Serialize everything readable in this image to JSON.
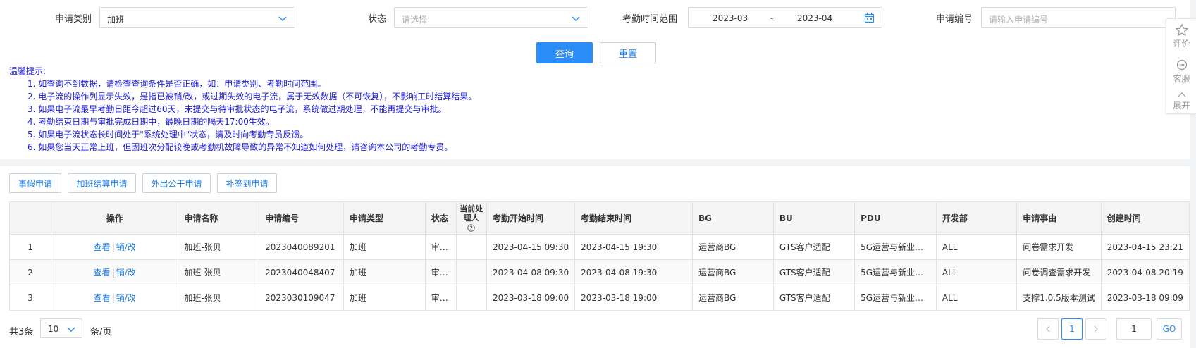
{
  "search": {
    "category_label": "申请类别",
    "category_value": "加班",
    "status_label": "状态",
    "status_placeholder": "请选择",
    "range_label": "考勤时间范围",
    "range_start": "2023-03",
    "range_sep": "-",
    "range_end": "2023-04",
    "number_label": "申请编号",
    "number_placeholder": "请输入申请编号",
    "query_button": "查询",
    "reset_button": "重置"
  },
  "tips": {
    "title": "温馨提示:",
    "items": [
      "1. 如查询不到数据，请检查查询条件是否正确，如：申请类别、考勤时间范围。",
      "2. 电子流的操作列显示失效，是指已被销/改，或过期失效的电子流，属于无效数据（不可恢复），不影响工时结算结果。",
      "3. 如果电子流最早考勤日距今超过60天，未提交与待审批状态的电子流，系统做过期处理，不能再提交与审批。",
      "4. 考勤结束日期与审批完成日期中，最晚日期的隔天17:00生效。",
      "5. 如果电子流状态长时间处于\"系统处理中\"状态，请及时向考勤专员反馈。",
      "6. 如果您当天正常上班，但因班次分配较晚或考勤机故障导致的异常不知道如何处理，请咨询本公司的考勤专员。"
    ]
  },
  "float_panel": {
    "rate_label": "评价",
    "service_label": "客服",
    "expand_label": "展开"
  },
  "tabs": [
    "事假申请",
    "加班结算申请",
    "外出公干申请",
    "补签到申请"
  ],
  "table": {
    "headers": {
      "index": "",
      "op": "操作",
      "name": "申请名称",
      "number": "申请编号",
      "type": "申请类型",
      "status": "状态",
      "handler": "当前处理人",
      "start": "考勤开始时间",
      "end": "考勤结束时间",
      "bg": "BG",
      "bu": "BU",
      "pdu": "PDU",
      "dept": "开发部",
      "reason": "申请事由",
      "created": "创建时间"
    },
    "view_label": "查看",
    "op_sep": "|",
    "edit_label": "销/改",
    "rows": [
      {
        "index": "1",
        "name": "加班-张贝",
        "number": "2023040089201",
        "type": "加班",
        "status": "审…",
        "handler": "",
        "start": "2023-04-15 09:30",
        "end": "2023-04-15 19:30",
        "bg": "运营商BG",
        "bu": "GTS客户适配",
        "pdu": "5G运营与新业…",
        "dept": "ALL",
        "reason": "问卷需求开发",
        "created": "2023-04-15 23:21"
      },
      {
        "index": "2",
        "name": "加班-张贝",
        "number": "2023040048407",
        "type": "加班",
        "status": "审…",
        "handler": "",
        "start": "2023-04-08 09:30",
        "end": "2023-04-08 19:30",
        "bg": "运营商BG",
        "bu": "GTS客户适配",
        "pdu": "5G运营与新业…",
        "dept": "ALL",
        "reason": "问卷调查需求开发",
        "created": "2023-04-08 20:19"
      },
      {
        "index": "3",
        "name": "加班-张贝",
        "number": "2023030109047",
        "type": "加班",
        "status": "审…",
        "handler": "",
        "start": "2023-03-18 09:00",
        "end": "2023-03-18 19:00",
        "bg": "运营商BG",
        "bu": "GTS客户适配",
        "pdu": "5G运营与新业…",
        "dept": "ALL",
        "reason": "支撑1.0.5版本测试",
        "created": "2023-03-18 09:09"
      }
    ]
  },
  "pager": {
    "total": "共3条",
    "page_size": "10",
    "per_page": "条/页",
    "current_page": "1",
    "jump_value": "1",
    "go_label": "GO"
  },
  "colors": {
    "primary": "#2a8cf7",
    "tips_text": "#1a1ad6",
    "link": "#1f7ee8"
  }
}
